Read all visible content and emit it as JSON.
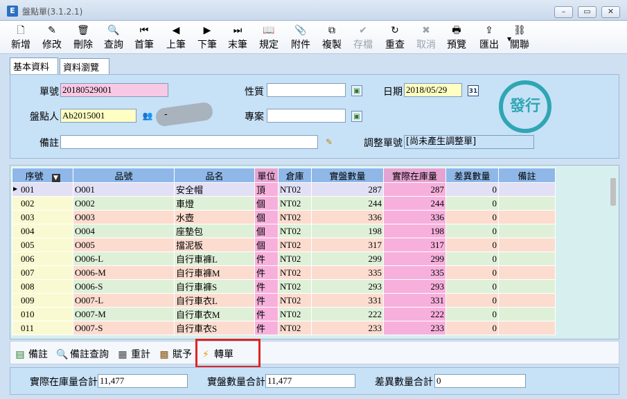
{
  "window": {
    "title": "盤點單(3.1.2.1)",
    "app_icon": "E",
    "buttons": [
      "minimize-icon",
      "maximize-icon",
      "close-icon"
    ]
  },
  "toolbar": [
    {
      "label": "新增",
      "icon": "new-doc-icon",
      "glyph": "🗋",
      "enabled": true
    },
    {
      "label": "修改",
      "icon": "edit-icon",
      "glyph": "✎",
      "enabled": true
    },
    {
      "label": "刪除",
      "icon": "trash-icon",
      "glyph": "🗑",
      "enabled": true
    },
    {
      "label": "查詢",
      "icon": "search-icon",
      "glyph": "🔍",
      "enabled": true
    },
    {
      "label": "首筆",
      "icon": "first-icon",
      "glyph": "⏮",
      "enabled": true
    },
    {
      "label": "上筆",
      "icon": "prev-icon",
      "glyph": "◀",
      "enabled": true
    },
    {
      "label": "下筆",
      "icon": "next-icon",
      "glyph": "▶",
      "enabled": true
    },
    {
      "label": "末筆",
      "icon": "last-icon",
      "glyph": "⏭",
      "enabled": true
    },
    {
      "label": "規定",
      "icon": "book-icon",
      "glyph": "📖",
      "enabled": true
    },
    {
      "label": "附件",
      "icon": "attach-icon",
      "glyph": "📎",
      "enabled": true
    },
    {
      "label": "複製",
      "icon": "copy-icon",
      "glyph": "⧉",
      "enabled": true
    },
    {
      "label": "存檔",
      "icon": "save-icon",
      "glyph": "✔",
      "enabled": false
    },
    {
      "label": "重查",
      "icon": "refresh-icon",
      "glyph": "↻",
      "enabled": true
    },
    {
      "label": "取消",
      "icon": "cancel-icon",
      "glyph": "✖",
      "enabled": false
    },
    {
      "label": "預覽",
      "icon": "preview-icon",
      "glyph": "🖶",
      "enabled": true
    },
    {
      "label": "匯出",
      "icon": "export-icon",
      "glyph": "⇪",
      "enabled": true
    },
    {
      "label": "關聯",
      "icon": "relation-icon",
      "glyph": "⛓",
      "enabled": true
    }
  ],
  "tabs": [
    "基本資料",
    "資料瀏覽"
  ],
  "form": {
    "doc_no_label": "單號",
    "doc_no": "20180529001",
    "counter_label": "盤點人",
    "counter": "Ab2015001",
    "note_label": "備註",
    "note": "",
    "nature_label": "性質",
    "nature": "",
    "project_label": "專案",
    "project": "",
    "date_label": "日期",
    "date": "2018/05/29",
    "adjust_label": "調整單號",
    "adjust": "[尚未產生調整單]",
    "stamp": "發行",
    "calendar_icon": "31",
    "separator": "-"
  },
  "grid": {
    "headers": [
      "序號",
      "品號",
      "品名",
      "單位",
      "倉庫",
      "實盤數量",
      "實際在庫量",
      "差異數量",
      "備註"
    ],
    "rows": [
      [
        "001",
        "O001",
        "安全帽",
        "頂",
        "NT02",
        "287",
        "287",
        "0",
        ""
      ],
      [
        "002",
        "O002",
        "車燈",
        "個",
        "NT02",
        "244",
        "244",
        "0",
        ""
      ],
      [
        "003",
        "O003",
        "水壺",
        "個",
        "NT02",
        "336",
        "336",
        "0",
        ""
      ],
      [
        "004",
        "O004",
        "座墊包",
        "個",
        "NT02",
        "198",
        "198",
        "0",
        ""
      ],
      [
        "005",
        "O005",
        "擋泥板",
        "個",
        "NT02",
        "317",
        "317",
        "0",
        ""
      ],
      [
        "006",
        "O006-L",
        "自行車褲L",
        "件",
        "NT02",
        "299",
        "299",
        "0",
        ""
      ],
      [
        "007",
        "O006-M",
        "自行車褲M",
        "件",
        "NT02",
        "335",
        "335",
        "0",
        ""
      ],
      [
        "008",
        "O006-S",
        "自行車褲S",
        "件",
        "NT02",
        "293",
        "293",
        "0",
        ""
      ],
      [
        "009",
        "O007-L",
        "自行車衣L",
        "件",
        "NT02",
        "331",
        "331",
        "0",
        ""
      ],
      [
        "010",
        "O007-M",
        "自行車衣M",
        "件",
        "NT02",
        "222",
        "222",
        "0",
        ""
      ],
      [
        "011",
        "O007-S",
        "自行車衣S",
        "件",
        "NT02",
        "233",
        "233",
        "0",
        ""
      ]
    ],
    "colors": {
      "seq": "#fafad2",
      "row_a": "#dff0d8",
      "row_b": "#fcdccf",
      "stock": "#f7b0dc",
      "first_row": "#e2e0f4"
    }
  },
  "bottom_buttons": [
    {
      "label": "備註",
      "icon": "note-icon",
      "glyph": "▤"
    },
    {
      "label": "備註查詢",
      "icon": "search-icon",
      "glyph": "🔍"
    },
    {
      "label": "重計",
      "icon": "calculator-icon",
      "glyph": "▦"
    },
    {
      "label": "賦予",
      "icon": "grid-assign-icon",
      "glyph": "▩"
    },
    {
      "label": "轉單",
      "icon": "lightning-icon",
      "glyph": "⚡"
    }
  ],
  "totals": {
    "stock_label": "實際在庫量合計",
    "stock": "11,477",
    "counted_label": "實盤數量合計",
    "counted": "11,477",
    "diff_label": "差異數量合計",
    "diff": "0"
  }
}
